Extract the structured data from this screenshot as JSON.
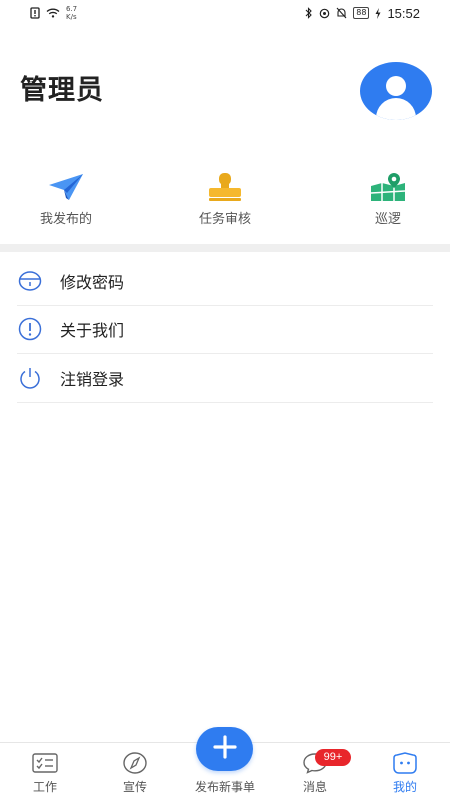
{
  "statusbar": {
    "net_speed_value": "6.7",
    "net_speed_unit": "K/s",
    "battery": "88",
    "time": "15:52"
  },
  "profile": {
    "name": "管理员"
  },
  "shortcuts": [
    {
      "label": "我发布的",
      "icon": "paper-plane-icon"
    },
    {
      "label": "任务审核",
      "icon": "stamp-icon"
    },
    {
      "label": "巡逻",
      "icon": "map-pin-icon"
    }
  ],
  "menu": [
    {
      "label": "修改密码",
      "icon": "lock-icon"
    },
    {
      "label": "关于我们",
      "icon": "info-icon"
    },
    {
      "label": "注销登录",
      "icon": "power-icon"
    }
  ],
  "tabs": [
    {
      "label": "工作",
      "icon": "checklist-icon"
    },
    {
      "label": "宣传",
      "icon": "compass-icon"
    },
    {
      "label": "发布新事单",
      "icon": "plus-icon"
    },
    {
      "label": "消息",
      "icon": "chat-icon"
    },
    {
      "label": "我的",
      "icon": "profile-icon"
    }
  ],
  "message_badge": "99+",
  "colors": {
    "accent": "#2f7cf0",
    "badge": "#e8262b",
    "shortcut_yellow": "#f5b82e",
    "shortcut_green": "#2db37a"
  }
}
